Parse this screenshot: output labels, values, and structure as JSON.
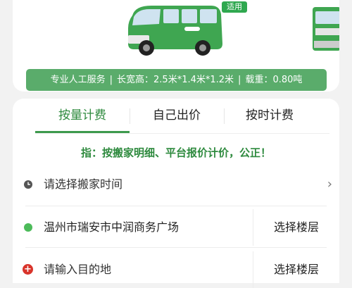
{
  "vehicle": {
    "badge": "适用",
    "icons": [
      "van-image",
      "truck-image"
    ]
  },
  "spec": {
    "service": "专业人工服务",
    "dimensions": "长宽高：2.5米*1.4米*1.2米",
    "load": "载重：0.80吨",
    "separator": "|"
  },
  "tabs": [
    {
      "label": "按量计费",
      "active": true
    },
    {
      "label": "自己出价",
      "active": false
    },
    {
      "label": "按时计费",
      "active": false
    }
  ],
  "notice": "指：按搬家明细、平台报价计价，公正！",
  "form": {
    "time_placeholder": "请选择搬家时间",
    "origin_address": "温州市瑞安市中润商务广场",
    "origin_floor": "选择楼层",
    "destination_placeholder": "请输入目的地",
    "destination_floor": "选择楼层"
  },
  "colors": {
    "brand_green": "#2e8a3e",
    "spec_bar": "#5aac6b",
    "origin_dot": "#4cbb5a",
    "destination_dot": "#d9342b"
  }
}
